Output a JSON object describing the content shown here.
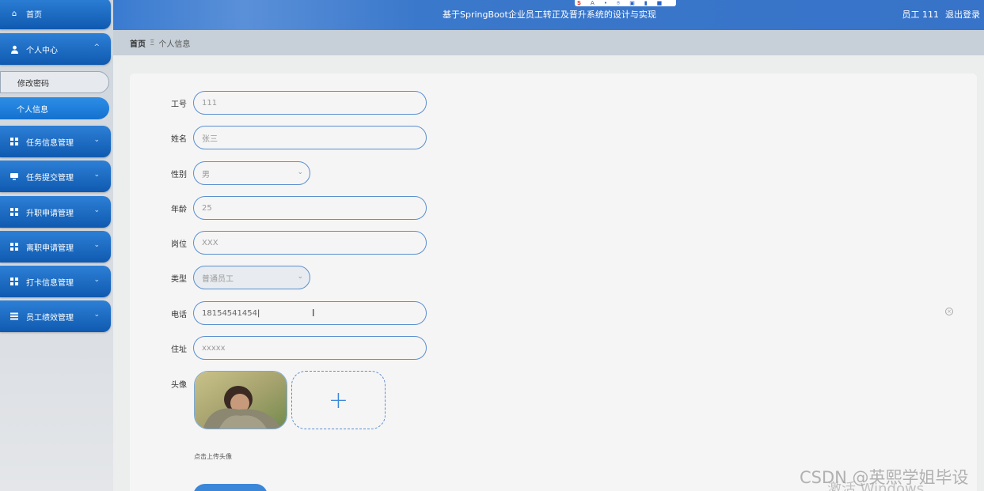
{
  "header": {
    "title": "基于SpringBoot企业员工转正及晋升系统的设计与实现",
    "user_label": "员工 111",
    "logout": "退出登录"
  },
  "toolbar": {
    "items": [
      "S",
      "A",
      "•",
      "⌾",
      "▣",
      "▮",
      "■"
    ]
  },
  "sidebar": {
    "home": "首页",
    "personal_center": "个人中心",
    "change_password": "修改密码",
    "personal_info": "个人信息",
    "items": [
      "任务信息管理",
      "任务提交管理",
      "升职申请管理",
      "离职申请管理",
      "打卡信息管理",
      "员工绩效管理"
    ]
  },
  "breadcrumb": {
    "home": "首页",
    "sep": "Ξ",
    "current": "个人信息"
  },
  "form": {
    "emp_no": {
      "label": "工号",
      "value": "111"
    },
    "name": {
      "label": "姓名",
      "value": "张三"
    },
    "gender": {
      "label": "性别",
      "value": "男"
    },
    "age": {
      "label": "年龄",
      "value": "25"
    },
    "position": {
      "label": "岗位",
      "value": "XXX"
    },
    "type": {
      "label": "类型",
      "value": "普通员工"
    },
    "phone": {
      "label": "电话",
      "value": "18154541454"
    },
    "address": {
      "label": "住址",
      "value": "xxxxx"
    },
    "avatar": {
      "label": "头像",
      "upload_tip": "点击上传头像"
    }
  },
  "watermark": {
    "csdn": "CSDN @英熙学姐毕设",
    "windows": "激活 Windows"
  },
  "colors": {
    "accent": "#3a86d8",
    "header": "#3773c8",
    "sidebar_button": "#1466c0"
  }
}
